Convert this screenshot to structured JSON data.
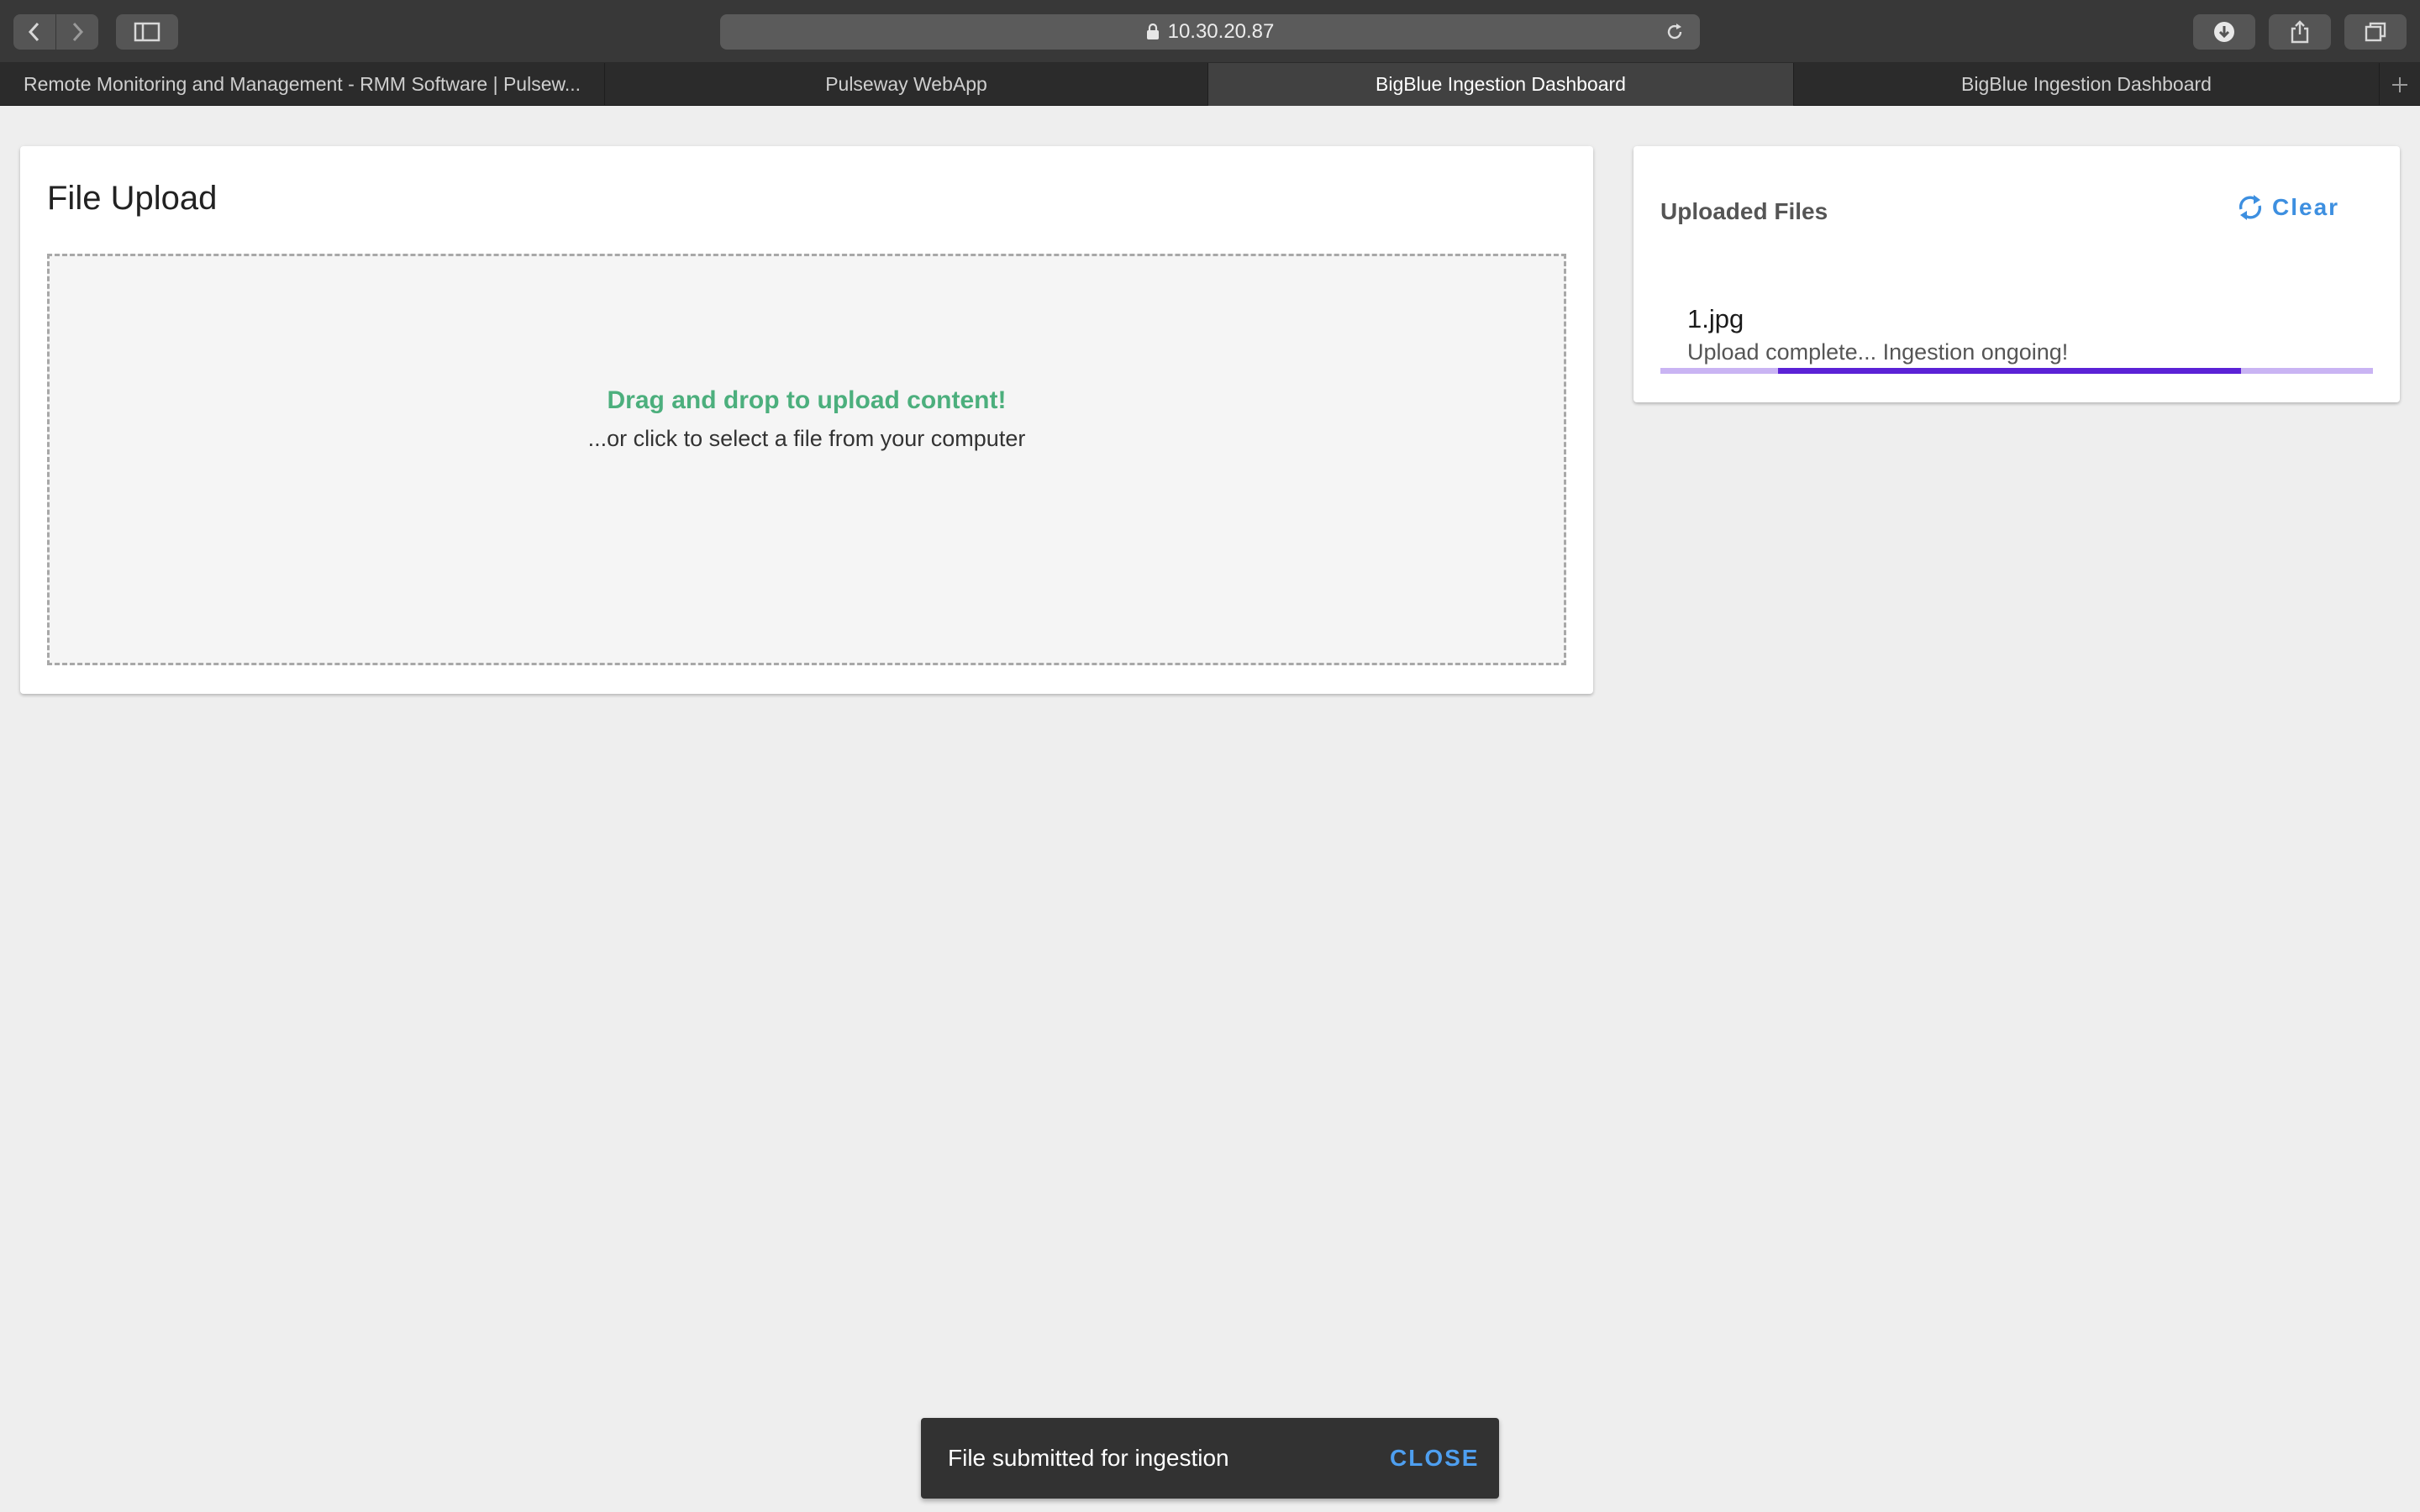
{
  "browser": {
    "url": "10.30.20.87",
    "tabs": [
      {
        "label": "Remote Monitoring and Management - RMM Software | Pulsew...",
        "active": false
      },
      {
        "label": "Pulseway WebApp",
        "active": false
      },
      {
        "label": "BigBlue Ingestion Dashboard",
        "active": true
      },
      {
        "label": "BigBlue Ingestion Dashboard",
        "active": false
      }
    ],
    "icons": {
      "back": "chevron-left-icon",
      "forward": "chevron-right-icon",
      "sidebar": "sidebar-icon",
      "lock": "lock-icon",
      "reload": "reload-icon",
      "download": "download-icon",
      "share": "share-icon",
      "tabs": "tab-overview-icon",
      "new_tab": "plus-icon"
    }
  },
  "upload": {
    "title": "File Upload",
    "drop_main": "Drag and drop to upload content!",
    "drop_sub": "...or click to select a file from your computer",
    "accent_color": "#4caf7d"
  },
  "files": {
    "title": "Uploaded Files",
    "clear_label": "Clear",
    "clear_icon": "refresh-icon",
    "items": [
      {
        "name": "1.jpg",
        "status": "Upload complete... Ingestion ongoing!",
        "progress": {
          "indeterminate": true,
          "bar_color": "#5b22d6",
          "track_color": "#c9b4f3"
        }
      }
    ]
  },
  "snackbar": {
    "message": "File submitted for ingestion",
    "action": "CLOSE"
  }
}
